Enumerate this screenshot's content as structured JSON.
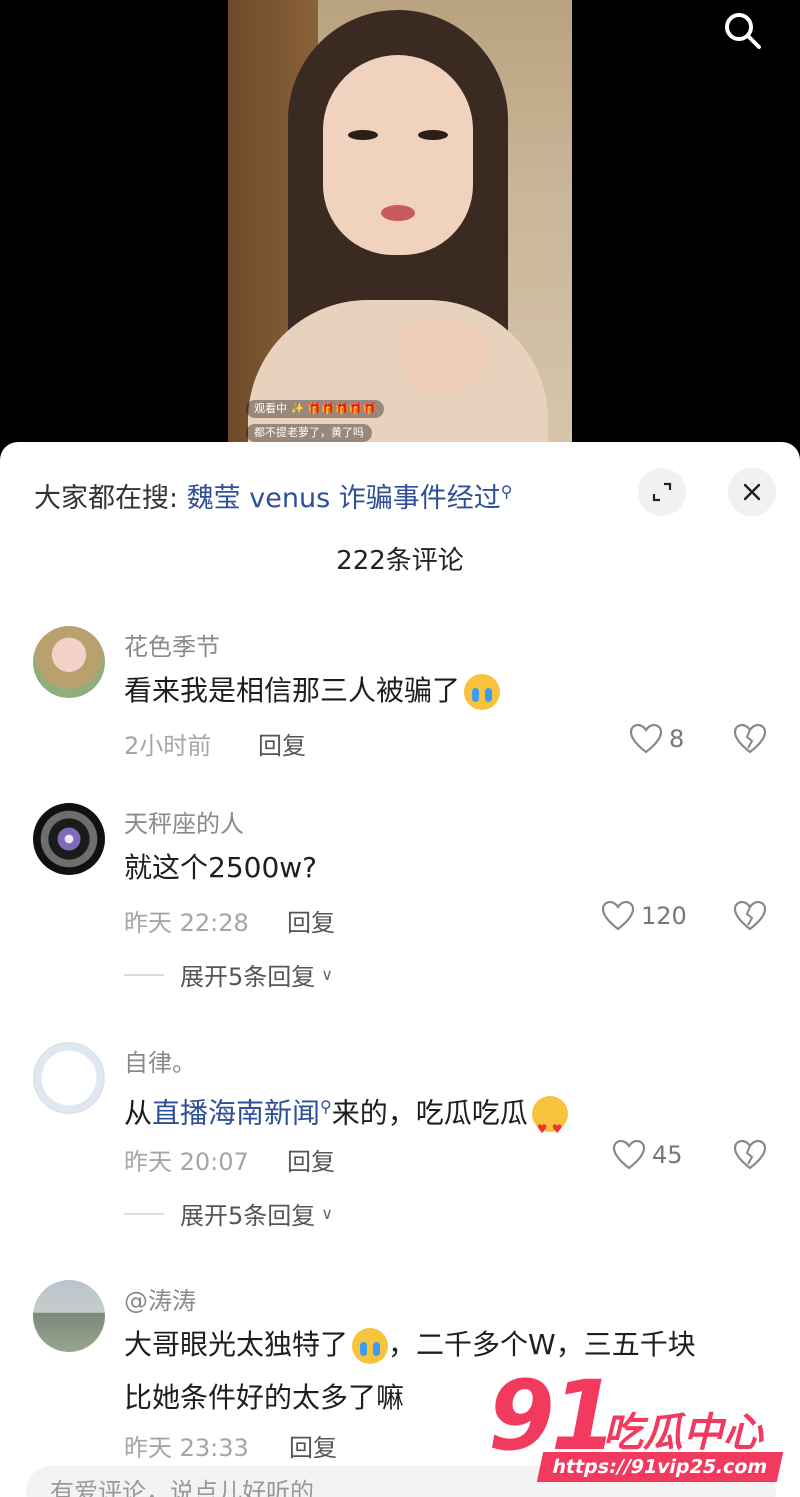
{
  "video": {
    "overlay_lines": [
      "都不提老萝了，黄了吗",
      "观看中 ✨ 🎁🎁🎁🎁🎁"
    ]
  },
  "sheet": {
    "hot_search_prefix": "大家都在搜: ",
    "hot_search_keyword": "魏莹 venus 诈骗事件经过",
    "comment_count_title": "222条评论"
  },
  "comments": [
    {
      "username": "花色季节",
      "text": "看来我是相信那三人被骗了",
      "emoji": "cry-laugh-icon",
      "time": "2小时前",
      "reply_label": "回复",
      "likes": "8"
    },
    {
      "username": "天秤座的人",
      "text": "就这个2500w?",
      "time": "昨天 22:28",
      "reply_label": "回复",
      "likes": "120",
      "expand_label": "展开5条回复"
    },
    {
      "username": "自律。",
      "text_prefix": "从",
      "text_link": "直播海南新闻",
      "text_suffix": "来的，吃瓜吃瓜",
      "emoji": "heart-eyes-icon",
      "time": "昨天 20:07",
      "reply_label": "回复",
      "likes": "45",
      "expand_label": "展开5条回复"
    },
    {
      "username": "@涛涛",
      "text_line1": "大哥眼光太独特了",
      "text_line1_after": "，二千多个W，三五千块",
      "text_line2": "比她条件好的太多了嘛",
      "emoji": "cry-laugh-icon",
      "time": "昨天 23:33",
      "reply_label": "回复"
    }
  ],
  "input": {
    "placeholder": "有爱评论，说点儿好听的"
  },
  "watermark": {
    "number": "91",
    "text": "吃瓜中心",
    "url": "https://91vip25.com"
  },
  "colors": {
    "link": "#2f4f97",
    "watermark": "#f23a5f"
  }
}
